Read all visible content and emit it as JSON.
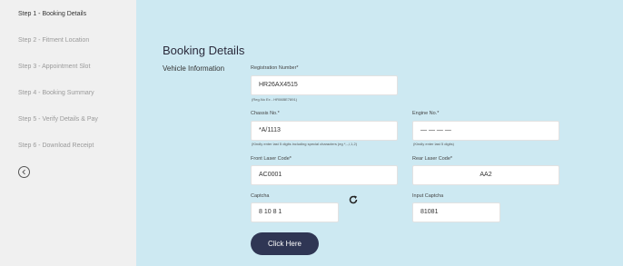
{
  "sidebar": {
    "steps": [
      {
        "label": "Step 1 - Booking Details"
      },
      {
        "label": "Step 2 - Fitment Location"
      },
      {
        "label": "Step 3 - Appointment Slot"
      },
      {
        "label": "Step 4 - Booking Summary"
      },
      {
        "label": "Step 5 - Verify Details & Pay"
      },
      {
        "label": "Step 6 - Download Receipt"
      }
    ],
    "active_step": 1,
    "back_icon": "chevron-left-icon"
  },
  "main": {
    "title": "Booking Details",
    "section": "Vehicle Information",
    "fields": {
      "registration": {
        "label": "Registration Number*",
        "value": "HR26AX4515",
        "hint": "(Reg.No Ex - HR06BE7891)"
      },
      "chassis": {
        "label": "Chassis No.*",
        "value": "*A/1113",
        "hint": "(Kindly enter last 5 digits including special characters (eg *,-,/,1,2)"
      },
      "engine": {
        "label": "Engine No.*",
        "value": "— — — —",
        "hint": "(Kindly enter last 5 digits)"
      },
      "front_laser": {
        "label": "Front Laser Code*",
        "value": "AC0001"
      },
      "rear_laser": {
        "label": "Rear Laser Code*",
        "value": "AA2"
      },
      "captcha": {
        "label": "Captcha",
        "value": "8 10  8 1"
      },
      "input_captcha": {
        "label": "Input Captcha",
        "value": "81081"
      }
    },
    "refresh_icon": "refresh-icon",
    "submit_label": "Click Here"
  },
  "colors": {
    "sidebar_bg": "#f0f0f0",
    "main_bg": "#cde9f2",
    "button_bg": "#2f3654"
  }
}
